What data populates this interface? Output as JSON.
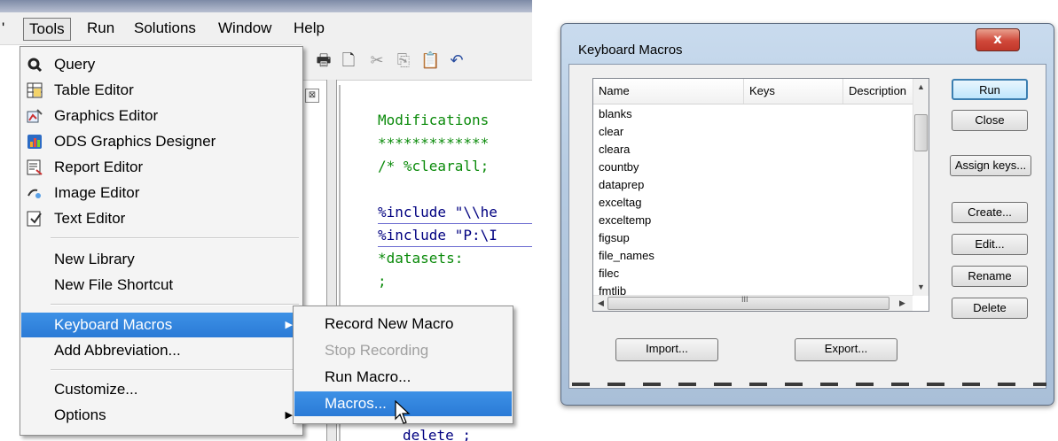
{
  "menubar": {
    "items": [
      "Tools",
      "Run",
      "Solutions",
      "Window",
      "Help"
    ]
  },
  "editor": {
    "lines": [
      {
        "text": "Modifications",
        "color": "#0a8a0a"
      },
      {
        "text": "*************",
        "color": "#0a8a0a"
      },
      {
        "text": "/* %clearall;",
        "color": "#0a8a0a"
      },
      {
        "text": "%include \"\\\\he",
        "color": "#000080"
      },
      {
        "text": "%include \"P:\\I",
        "color": "#000080"
      },
      {
        "text": "*datasets:",
        "color": "#0a8a0a"
      },
      {
        "text": ";",
        "color": "#0a8a0a"
      },
      {
        "text": "delete ;",
        "color": "#000080"
      }
    ],
    "pane_close_glyph": "⊠"
  },
  "tools_menu": {
    "items": [
      {
        "label": "Query",
        "icon": "query-icon"
      },
      {
        "label": "Table Editor",
        "icon": "table-editor-icon"
      },
      {
        "label": "Graphics Editor",
        "icon": "graphics-editor-icon"
      },
      {
        "label": "ODS Graphics Designer",
        "icon": "ods-graphics-icon"
      },
      {
        "label": "Report Editor",
        "icon": "report-editor-icon"
      },
      {
        "label": "Image Editor",
        "icon": "image-editor-icon"
      },
      {
        "label": "Text Editor",
        "icon": "text-editor-icon"
      },
      {
        "label": "New Library"
      },
      {
        "label": "New File Shortcut"
      },
      {
        "label": "Keyboard Macros",
        "highlighted": true,
        "has_submenu": true
      },
      {
        "label": "Add Abbreviation..."
      },
      {
        "label": "Customize..."
      },
      {
        "label": "Options",
        "has_submenu": true
      }
    ],
    "highlight_color": "#3284dc"
  },
  "keyboard_macros_submenu": {
    "items": [
      {
        "label": "Record New Macro"
      },
      {
        "label": "Stop Recording",
        "disabled": true
      },
      {
        "label": "Run Macro..."
      },
      {
        "label": "Macros...",
        "highlighted": true
      }
    ]
  },
  "dialog": {
    "title": "Keyboard Macros",
    "close_glyph": "x",
    "columns": [
      "Name",
      "Keys",
      "Description"
    ],
    "macros": [
      "blanks",
      "clear",
      "cleara",
      "countby",
      "dataprep",
      "exceltag",
      "exceltemp",
      "figsup",
      "file_names",
      "filec",
      "fmtlib"
    ],
    "scroll_glyph": "III",
    "buttons": {
      "run": "Run",
      "close": "Close",
      "assign_keys": "Assign keys...",
      "create": "Create...",
      "edit": "Edit...",
      "rename": "Rename",
      "delete": "Delete",
      "import": "Import...",
      "export": "Export..."
    }
  }
}
